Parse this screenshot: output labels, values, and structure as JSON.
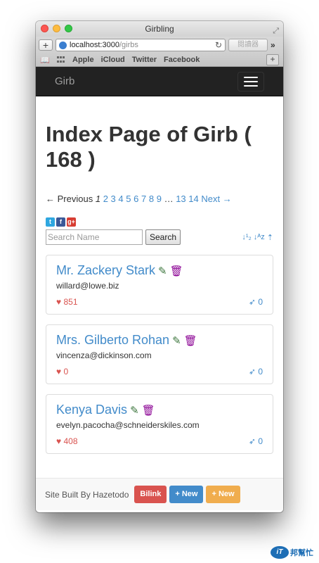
{
  "window": {
    "title": "Girbling"
  },
  "browser": {
    "url_host": "localhost:3000",
    "url_path": "/girbs",
    "reader_label": "閱讀器",
    "bookmarks": [
      "Apple",
      "iCloud",
      "Twitter",
      "Facebook"
    ]
  },
  "navbar": {
    "brand": "Girb"
  },
  "page": {
    "title": "Index Page of Girb ( 168 )"
  },
  "pagination": {
    "previous": "← Previous",
    "current": "1",
    "pages": [
      "2",
      "3",
      "4",
      "5",
      "6",
      "7",
      "8",
      "9"
    ],
    "gap": "…",
    "tail_pages": [
      "13",
      "14"
    ],
    "next": "Next →"
  },
  "search": {
    "placeholder": "Search Name",
    "button": "Search"
  },
  "cards": [
    {
      "name": "Mr. Zackery Stark",
      "email": "willard@lowe.biz",
      "likes": "851",
      "launches": "0"
    },
    {
      "name": "Mrs. Gilberto Rohan",
      "email": "vincenza@dickinson.com",
      "likes": "0",
      "launches": "0"
    },
    {
      "name": "Kenya Davis",
      "email": "evelyn.pacocha@schneiderskiles.com",
      "likes": "408",
      "launches": "0"
    }
  ],
  "footer": {
    "credit": "Site Built By Hazetodo",
    "bilink": "Bilink",
    "new_blue": "+ New",
    "new_orange": "+ New"
  },
  "watermark": {
    "badge": "iT",
    "text": "邦幫忙"
  },
  "colors": {
    "link": "#428bca",
    "like": "#d9534f",
    "edit": "#3c763d",
    "trash": "#8a0093",
    "navbar": "#222222"
  }
}
